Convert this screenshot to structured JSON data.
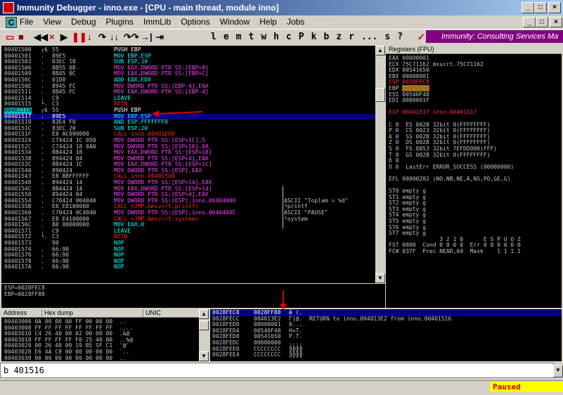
{
  "window": {
    "title": "Immunity Debugger - inno.exe - [CPU - main thread, module inno]"
  },
  "menu": [
    "File",
    "View",
    "Debug",
    "Plugins",
    "ImmLib",
    "Options",
    "Window",
    "Help",
    "Jobs"
  ],
  "toolbar": {
    "letters": [
      "l",
      "e",
      "m",
      "t",
      "w",
      "h",
      "c",
      "P",
      "k",
      "b",
      "z",
      "r",
      "...",
      "s",
      "?"
    ],
    "banner": "Immunity: Consulting Services Ma"
  },
  "disasm": [
    {
      "addr": "00401500",
      "mark": "┌$",
      "hex": "55",
      "asm": "PUSH EBP",
      "cls": "w"
    },
    {
      "addr": "00401501",
      "mark": ".",
      "hex": "89E5",
      "asm": "MOV EBP,ESP",
      "cls": "c"
    },
    {
      "addr": "00401503",
      "mark": ".",
      "hex": "83EC 10",
      "asm": "SUB ESP,10",
      "cls": "c"
    },
    {
      "addr": "00401506",
      "mark": ".",
      "hex": "8B55 08",
      "asm": "MOV EDX,DWORD PTR SS:[EBP+8]",
      "cls": "m"
    },
    {
      "addr": "00401509",
      "mark": ".",
      "hex": "8B45 0C",
      "asm": "MOV EAX,DWORD PTR SS:[EBP+C]",
      "cls": "m"
    },
    {
      "addr": "0040150C",
      "mark": ".",
      "hex": "01D0",
      "asm": "ADD EAX,EDX",
      "cls": "c"
    },
    {
      "addr": "0040150E",
      "mark": ".",
      "hex": "8945 FC",
      "asm": "MOV DWORD PTR SS:[EBP-4],EAX",
      "cls": "m"
    },
    {
      "addr": "00401511",
      "mark": ".",
      "hex": "8B45 FC",
      "asm": "MOV EAX,DWORD PTR SS:[EBP-4]",
      "cls": "m"
    },
    {
      "addr": "00401514",
      "mark": ".",
      "hex": "C9",
      "asm": "LEAVE",
      "cls": "c"
    },
    {
      "addr": "00401515",
      "mark": "└.",
      "hex": "C3",
      "asm": "RETN",
      "cls": "r"
    },
    {
      "addr": "00401516",
      "mark": "┌$",
      "hex": "55",
      "asm": "PUSH EBP",
      "cls": "w",
      "eip": true
    },
    {
      "addr": "00401517",
      "mark": ".",
      "hex": "89E5",
      "asm": "MOV EBP,ESP",
      "cls": "c",
      "sel": true
    },
    {
      "addr": "00401519",
      "mark": ".",
      "hex": "83E4 F0",
      "asm": "AND ESP,FFFFFFF0",
      "cls": "c"
    },
    {
      "addr": "0040151C",
      "mark": ".",
      "hex": "83EC 20",
      "asm": "SUB ESP,20",
      "cls": "c"
    },
    {
      "addr": "0040151F",
      "mark": ".",
      "hex": "E8 AC090000",
      "asm": "CALL inno.00401ED0",
      "cls": "r"
    },
    {
      "addr": "00401524",
      "mark": ".",
      "hex": "C74424 1C 050",
      "asm": "MOV DWORD PTR SS:[ESP+1C],5",
      "cls": "m"
    },
    {
      "addr": "0040152C",
      "mark": ".",
      "hex": "C74424 18 0A0",
      "asm": "MOV DWORD PTR SS:[ESP+18],0A",
      "cls": "m"
    },
    {
      "addr": "00401534",
      "mark": ".",
      "hex": "8B4424 18",
      "asm": "MOV EAX,DWORD PTR SS:[ESP+18]",
      "cls": "m"
    },
    {
      "addr": "00401538",
      "mark": ".",
      "hex": "894424 04",
      "asm": "MOV DWORD PTR SS:[ESP+4],EAX",
      "cls": "m"
    },
    {
      "addr": "0040153C",
      "mark": ".",
      "hex": "8B4424 1C",
      "asm": "MOV EAX,DWORD PTR SS:[ESP+1C]",
      "cls": "m"
    },
    {
      "addr": "00401540",
      "mark": ".",
      "hex": "890424",
      "asm": "MOV DWORD PTR SS:[ESP],EAX",
      "cls": "m"
    },
    {
      "addr": "00401543",
      "mark": ".",
      "hex": "E8 B8FFFFFF",
      "asm": "CALL inno.00401500",
      "cls": "r"
    },
    {
      "addr": "00401548",
      "mark": ".",
      "hex": "894424 14",
      "asm": "MOV DWORD PTR SS:[ESP+14],EAX",
      "cls": "m"
    },
    {
      "addr": "0040154C",
      "mark": ".",
      "hex": "8B4424 14",
      "asm": "MOV EAX,DWORD PTR SS:[ESP+14]",
      "cls": "m"
    },
    {
      "addr": "00401550",
      "mark": ".",
      "hex": "894424 04",
      "asm": "MOV DWORD PTR SS:[ESP+4],EAX",
      "cls": "m"
    },
    {
      "addr": "00401554",
      "mark": ".",
      "hex": "C70424 004040",
      "asm": "MOV DWORD PTR SS:[ESP],inno.00404000",
      "cls": "m",
      "cmt": "ASCII \"Toplam = %d\""
    },
    {
      "addr": "0040155B",
      "mark": ".",
      "hex": "E8 E8100000",
      "asm": "CALL <JMP.&msvcrt.printf>",
      "cls": "r",
      "cmt": "└printf"
    },
    {
      "addr": "00401560",
      "mark": ".",
      "hex": "C70424 0C4040",
      "asm": "MOV DWORD PTR SS:[ESP],inno.0040400C",
      "cls": "m",
      "cmt": "ASCII \"PAUSE\""
    },
    {
      "addr": "00401567",
      "mark": ".",
      "hex": "E8 E4100000",
      "asm": "CALL <JMP.&msvcrt.system>",
      "cls": "r",
      "cmt": "└system"
    },
    {
      "addr": "0040156C",
      "mark": ".",
      "hex": "B8 00000000",
      "asm": "MOV EAX,0",
      "cls": "c"
    },
    {
      "addr": "00401571",
      "mark": ".",
      "hex": "C9",
      "asm": "LEAVE",
      "cls": "c"
    },
    {
      "addr": "00401572",
      "mark": "└.",
      "hex": "C3",
      "asm": "RETN",
      "cls": "r"
    },
    {
      "addr": "00401573",
      "mark": "",
      "hex": "90",
      "asm": "NOP",
      "cls": "c"
    },
    {
      "addr": "00401574",
      "mark": ".",
      "hex": "66:90",
      "asm": "NOP",
      "cls": "c"
    },
    {
      "addr": "00401576",
      "mark": ".",
      "hex": "66:90",
      "asm": "NOP",
      "cls": "c"
    },
    {
      "addr": "00401578",
      "mark": ".",
      "hex": "66:90",
      "asm": "NOP",
      "cls": "c"
    },
    {
      "addr": "0040157A",
      "mark": ".",
      "hex": "66:90",
      "asm": "NOP",
      "cls": "c"
    }
  ],
  "info": [
    "ESP=0028FEC8",
    "EBP=0028FF88"
  ],
  "registers": {
    "header": "Registers (FPU)",
    "lines": [
      {
        "t": "EAX 00000001",
        "hl": ""
      },
      {
        "t": "ECX 75C71162 msvcrt.75C71162",
        "hl": ""
      },
      {
        "t": "EDX 00541650",
        "hl": ""
      },
      {
        "t": "EBX 00000001",
        "hl": ""
      },
      {
        "t": "ESP 0028FEC8",
        "hl": "red"
      },
      {
        "t": "EBP 0028FF88",
        "hl": "yellow"
      },
      {
        "t": "ESI 00540F48",
        "hl": ""
      },
      {
        "t": "EDI 0000001F",
        "hl": ""
      },
      {
        "t": "",
        "hl": ""
      },
      {
        "t": "EIP 00401517 inno.00401517",
        "hl": "red"
      },
      {
        "t": "",
        "hl": ""
      },
      {
        "t": "C 0  ES 002B 32bit 0(FFFFFFFF)",
        "hl": ""
      },
      {
        "t": "P 0  CS 0023 32bit 0(FFFFFFFF)",
        "hl": ""
      },
      {
        "t": "A 0  SS 002B 32bit 0(FFFFFFFF)",
        "hl": ""
      },
      {
        "t": "Z 0  DS 002B 32bit 0(FFFFFFFF)",
        "hl": ""
      },
      {
        "t": "S 0  FS 0053 32bit 7EFDD000(FFF)",
        "hl": ""
      },
      {
        "t": "T 0  GS 002B 32bit 0(FFFFFFFF)",
        "hl": ""
      },
      {
        "t": "D 0",
        "hl": ""
      },
      {
        "t": "O 0  LastErr ERROR_SUCCESS (00000000)",
        "hl": ""
      },
      {
        "t": "",
        "hl": ""
      },
      {
        "t": "EFL 00000202 (NO,NB,NE,A,NS,PO,GE,G)",
        "hl": ""
      },
      {
        "t": "",
        "hl": ""
      },
      {
        "t": "ST0 empty g",
        "hl": ""
      },
      {
        "t": "ST1 empty g",
        "hl": ""
      },
      {
        "t": "ST2 empty g",
        "hl": ""
      },
      {
        "t": "ST3 empty g",
        "hl": ""
      },
      {
        "t": "ST4 empty g",
        "hl": ""
      },
      {
        "t": "ST5 empty g",
        "hl": ""
      },
      {
        "t": "ST6 empty g",
        "hl": ""
      },
      {
        "t": "ST7 empty g",
        "hl": ""
      },
      {
        "t": "               3 2 1 0      E S P U O Z",
        "hl": ""
      },
      {
        "t": "FST 0000  Cond 0 0 0 0  Err 0 0 0 0 0 0",
        "hl": ""
      },
      {
        "t": "FCW 037F  Prec NEAR,64  Mask    1 1 1 1",
        "hl": ""
      }
    ]
  },
  "hexdump": {
    "headers": [
      "Address",
      "Hex dump",
      "UNIC"
    ],
    "rows": [
      "00403000 0A 00 00 00 FF 00 00 00  ..",
      "00403008 FF FF FF FF FF FF FF FF  ....",
      "00403010 C4 26 40 00 02 00 00 00  .&@",
      "00403018 FF FF FF FF F0 25 40 00  ..%@",
      "00403020 00 26 40 00 19 B5 SF C1  '@'",
      "00403028 E6 4A C8 00 00 00 00 00  `..",
      "00403030 00 00 00 00 00 00 00 00  .."
    ]
  },
  "stack": [
    {
      "addr": "0028FEC8",
      "val": "0028FF88",
      "cmt": "ê (.",
      "sel": true
    },
    {
      "addr": "0028FECC",
      "val": "004013E2",
      "cmt": "Γ|@.  RETURN to inno.004013E2 from inno.00401516"
    },
    {
      "addr": "0028FED0",
      "val": "00000001",
      "cmt": "0..."
    },
    {
      "addr": "0028FED4",
      "val": "00540F48",
      "cmt": "H¤T."
    },
    {
      "addr": "0028FED8",
      "val": "00541650",
      "cmt": "P.T."
    },
    {
      "addr": "0028FEDC",
      "val": "00000000",
      "cmt": "...."
    },
    {
      "addr": "0028FEE0",
      "val": "CCCCCCCC",
      "cmt": "╠╠╠╠"
    },
    {
      "addr": "0028FEE4",
      "val": "CCCCCCCC",
      "cmt": "╠╠╠╠"
    }
  ],
  "command": {
    "value": "b 401516"
  },
  "status": {
    "paused": "Paused"
  }
}
